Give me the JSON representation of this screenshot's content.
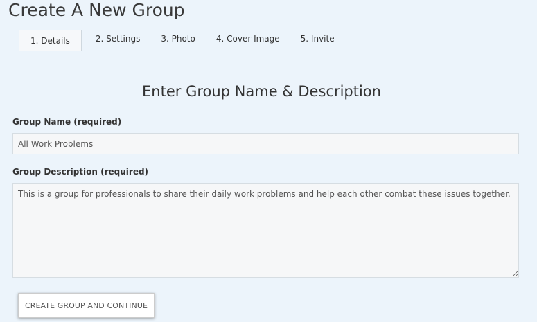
{
  "page": {
    "title": "Create A New Group",
    "heading": "Enter Group Name & Description"
  },
  "tabs": [
    {
      "label": "1. Details",
      "active": true
    },
    {
      "label": "2. Settings",
      "active": false
    },
    {
      "label": "3. Photo",
      "active": false
    },
    {
      "label": "4. Cover Image",
      "active": false
    },
    {
      "label": "5. Invite",
      "active": false
    }
  ],
  "form": {
    "name_label": "Group Name (required)",
    "name_value": "All Work Problems",
    "description_label": "Group Description (required)",
    "description_value": "This is a group for professionals to share their daily work problems and help each other combat these issues together.",
    "submit_label": "CREATE GROUP AND CONTINUE"
  },
  "colors": {
    "background": "#ecf4fb",
    "field_background": "#f6f7f8"
  }
}
